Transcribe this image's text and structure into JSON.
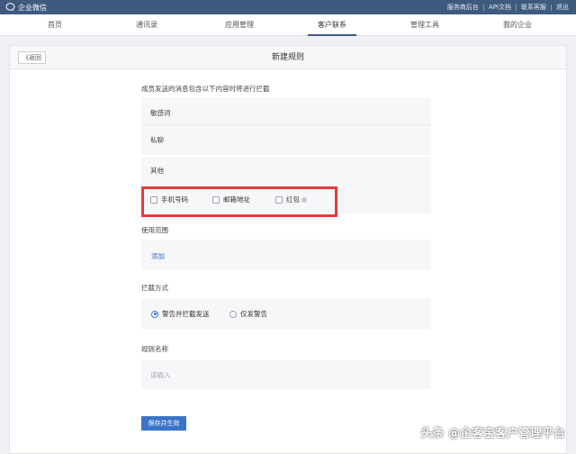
{
  "topbar": {
    "brand": "企业微信",
    "links": [
      "服务商后台",
      "API文档",
      "联系客服",
      "退出"
    ]
  },
  "nav": {
    "items": [
      "首页",
      "通讯录",
      "应用管理",
      "客户联系",
      "管理工具",
      "我的企业"
    ],
    "active": "客户联系"
  },
  "page": {
    "back": "《返回",
    "title": "新建规则"
  },
  "intercept": {
    "label": "成员发送的消息包含以下内容时将进行拦截",
    "sensitive": "敏感词",
    "private_chat": "私聊",
    "other": "其他",
    "options": [
      "手机号码",
      "邮箱地址",
      "红包"
    ]
  },
  "scope": {
    "label": "使用范围",
    "add": "添加"
  },
  "method": {
    "label": "拦截方式",
    "options": [
      "警告并拦截发送",
      "仅发警告"
    ],
    "selected": "警告并拦截发送"
  },
  "rule_name": {
    "label": "规则名称",
    "placeholder": "请输入"
  },
  "save": "保存并生效",
  "watermark": "头条 @企客宝客户管理平台",
  "colors": {
    "topbar": "#3e5a7e",
    "primary": "#3b74c7",
    "highlight": "#e83a3a"
  }
}
